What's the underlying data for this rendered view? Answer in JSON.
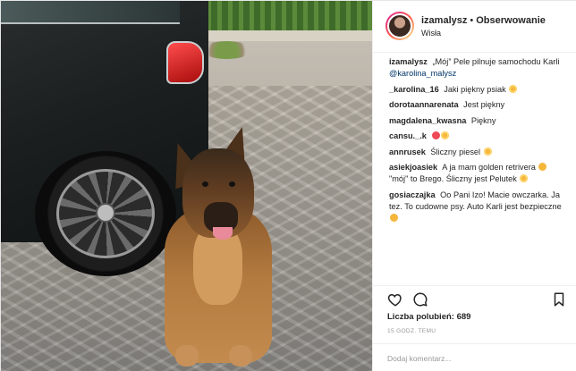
{
  "post": {
    "header": {
      "username": "izamalysz",
      "separator": "•",
      "follow_label": "Obserwowanie",
      "location": "Wisła"
    },
    "caption": {
      "username": "izamalysz",
      "text": "„Mój” Pele pilnuje samochodu Karli",
      "mention": "@karolina_malysz"
    },
    "comments": [
      {
        "username": "_karolina_16",
        "text": "Jaki piękny psiak",
        "emoji": "heart-eyes-emoji"
      },
      {
        "username": "dorotaannarenata",
        "text": "Jest piękny",
        "emoji": ""
      },
      {
        "username": "magdalena_kwasna",
        "text": "Piękny",
        "emoji": ""
      },
      {
        "username": "cansu._.k",
        "text": "",
        "emoji": "heart-emoji"
      },
      {
        "username": "annrusek",
        "text": "Śliczny piesel",
        "emoji": "heart-eyes-emoji"
      },
      {
        "username": "asiekjoasiek",
        "text": "A ja mam golden retrivera",
        "text2": "\"mój\" to Brego. Śliczny jest Pelutek",
        "emoji": "smile-emoji"
      },
      {
        "username": "gosiaczajka",
        "text": "Oo Pani Izo! Macie owczarka. Ja tez. To cudowne psy. Auto Karli jest bezpieczne",
        "emoji": "kiss-emoji"
      }
    ],
    "likes_label": "Liczba polubień: 689",
    "timestamp": "15 GODZ. TEMU",
    "comment_placeholder": "Dodaj komentarz..."
  },
  "colors": {
    "text": "#262626",
    "muted": "#999999",
    "mention": "#003569",
    "heart": "#ed4956"
  }
}
